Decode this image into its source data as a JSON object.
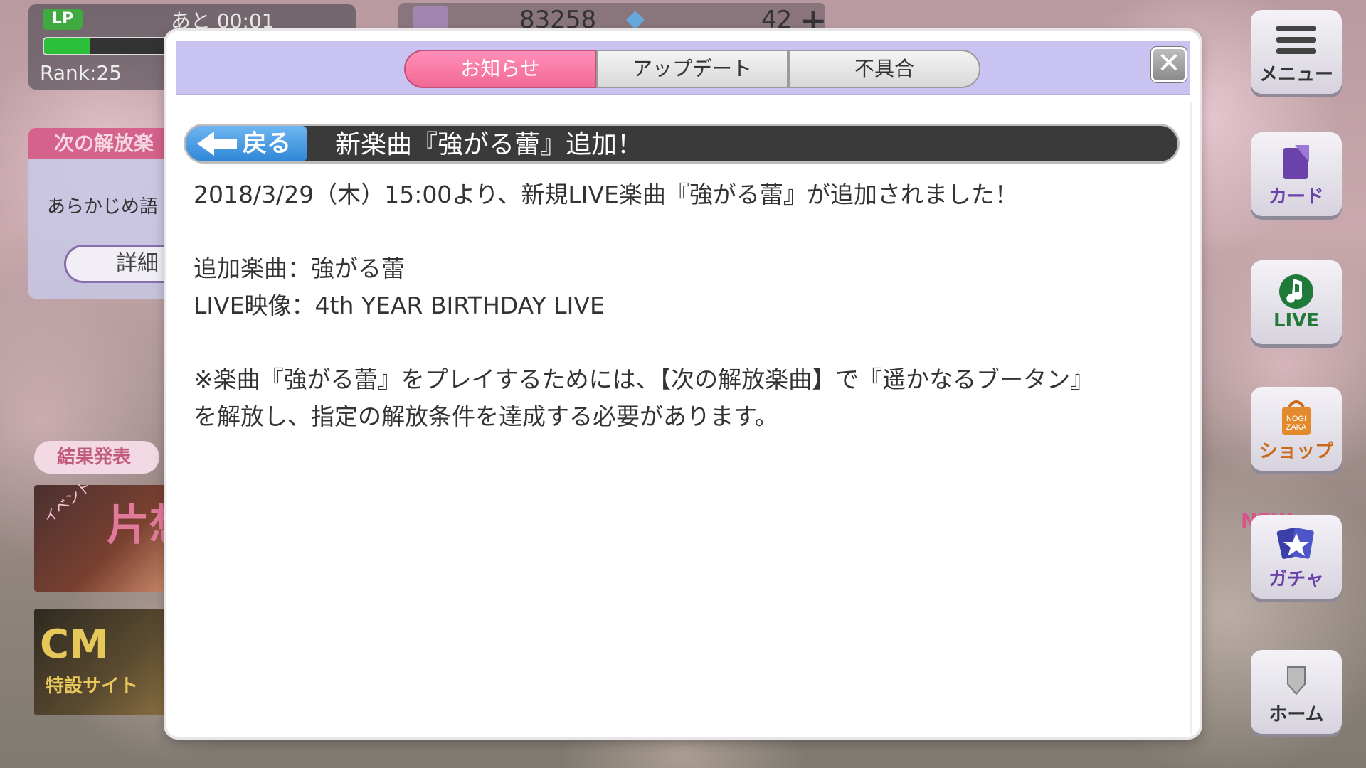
{
  "hud": {
    "lp_label": "LP",
    "lp_timer": "あと 00:01",
    "lp_fill": 0.35,
    "rank": "Rank:25",
    "coins": "83258",
    "gems": "42"
  },
  "left_panel": {
    "next_unlock_title": "次の解放楽",
    "next_unlock_text": "あらかじめ語",
    "details_button": "詳細",
    "results_badge": "結果発表",
    "event_tag": "イベント",
    "event_kanji": "片想",
    "cm_text": "CM",
    "cm_sub": "特設サイト"
  },
  "side_menu": {
    "menu": "メニュー",
    "card": "カード",
    "live": "LIVE",
    "shop": "ショップ",
    "gacha": "ガチャ",
    "home": "ホーム",
    "new_badge": "NEW"
  },
  "modal": {
    "tabs": [
      {
        "label": "お知らせ",
        "active": true
      },
      {
        "label": "アップデート",
        "active": false
      },
      {
        "label": "不具合",
        "active": false
      }
    ],
    "close_symbol": "✕",
    "back_label": "戻る",
    "title": "新楽曲『強がる蕾』追加！",
    "lines": [
      "2018/3/29（木）15:00より、新規LIVE楽曲『強がる蕾』が追加されました！",
      "",
      "追加楽曲：強がる蕾",
      "LIVE映像：4th YEAR BIRTHDAY LIVE",
      "",
      "※楽曲『強がる蕾』をプレイするためには、【次の解放楽曲】で『遥かなるブータン』",
      "を解放し、指定の解放条件を達成する必要があります。"
    ]
  },
  "colors": {
    "active_tab": "#f26996",
    "header_bg": "#c9c3f2",
    "title_bar": "#3a3a3a",
    "back_button": "#2f87d6"
  }
}
